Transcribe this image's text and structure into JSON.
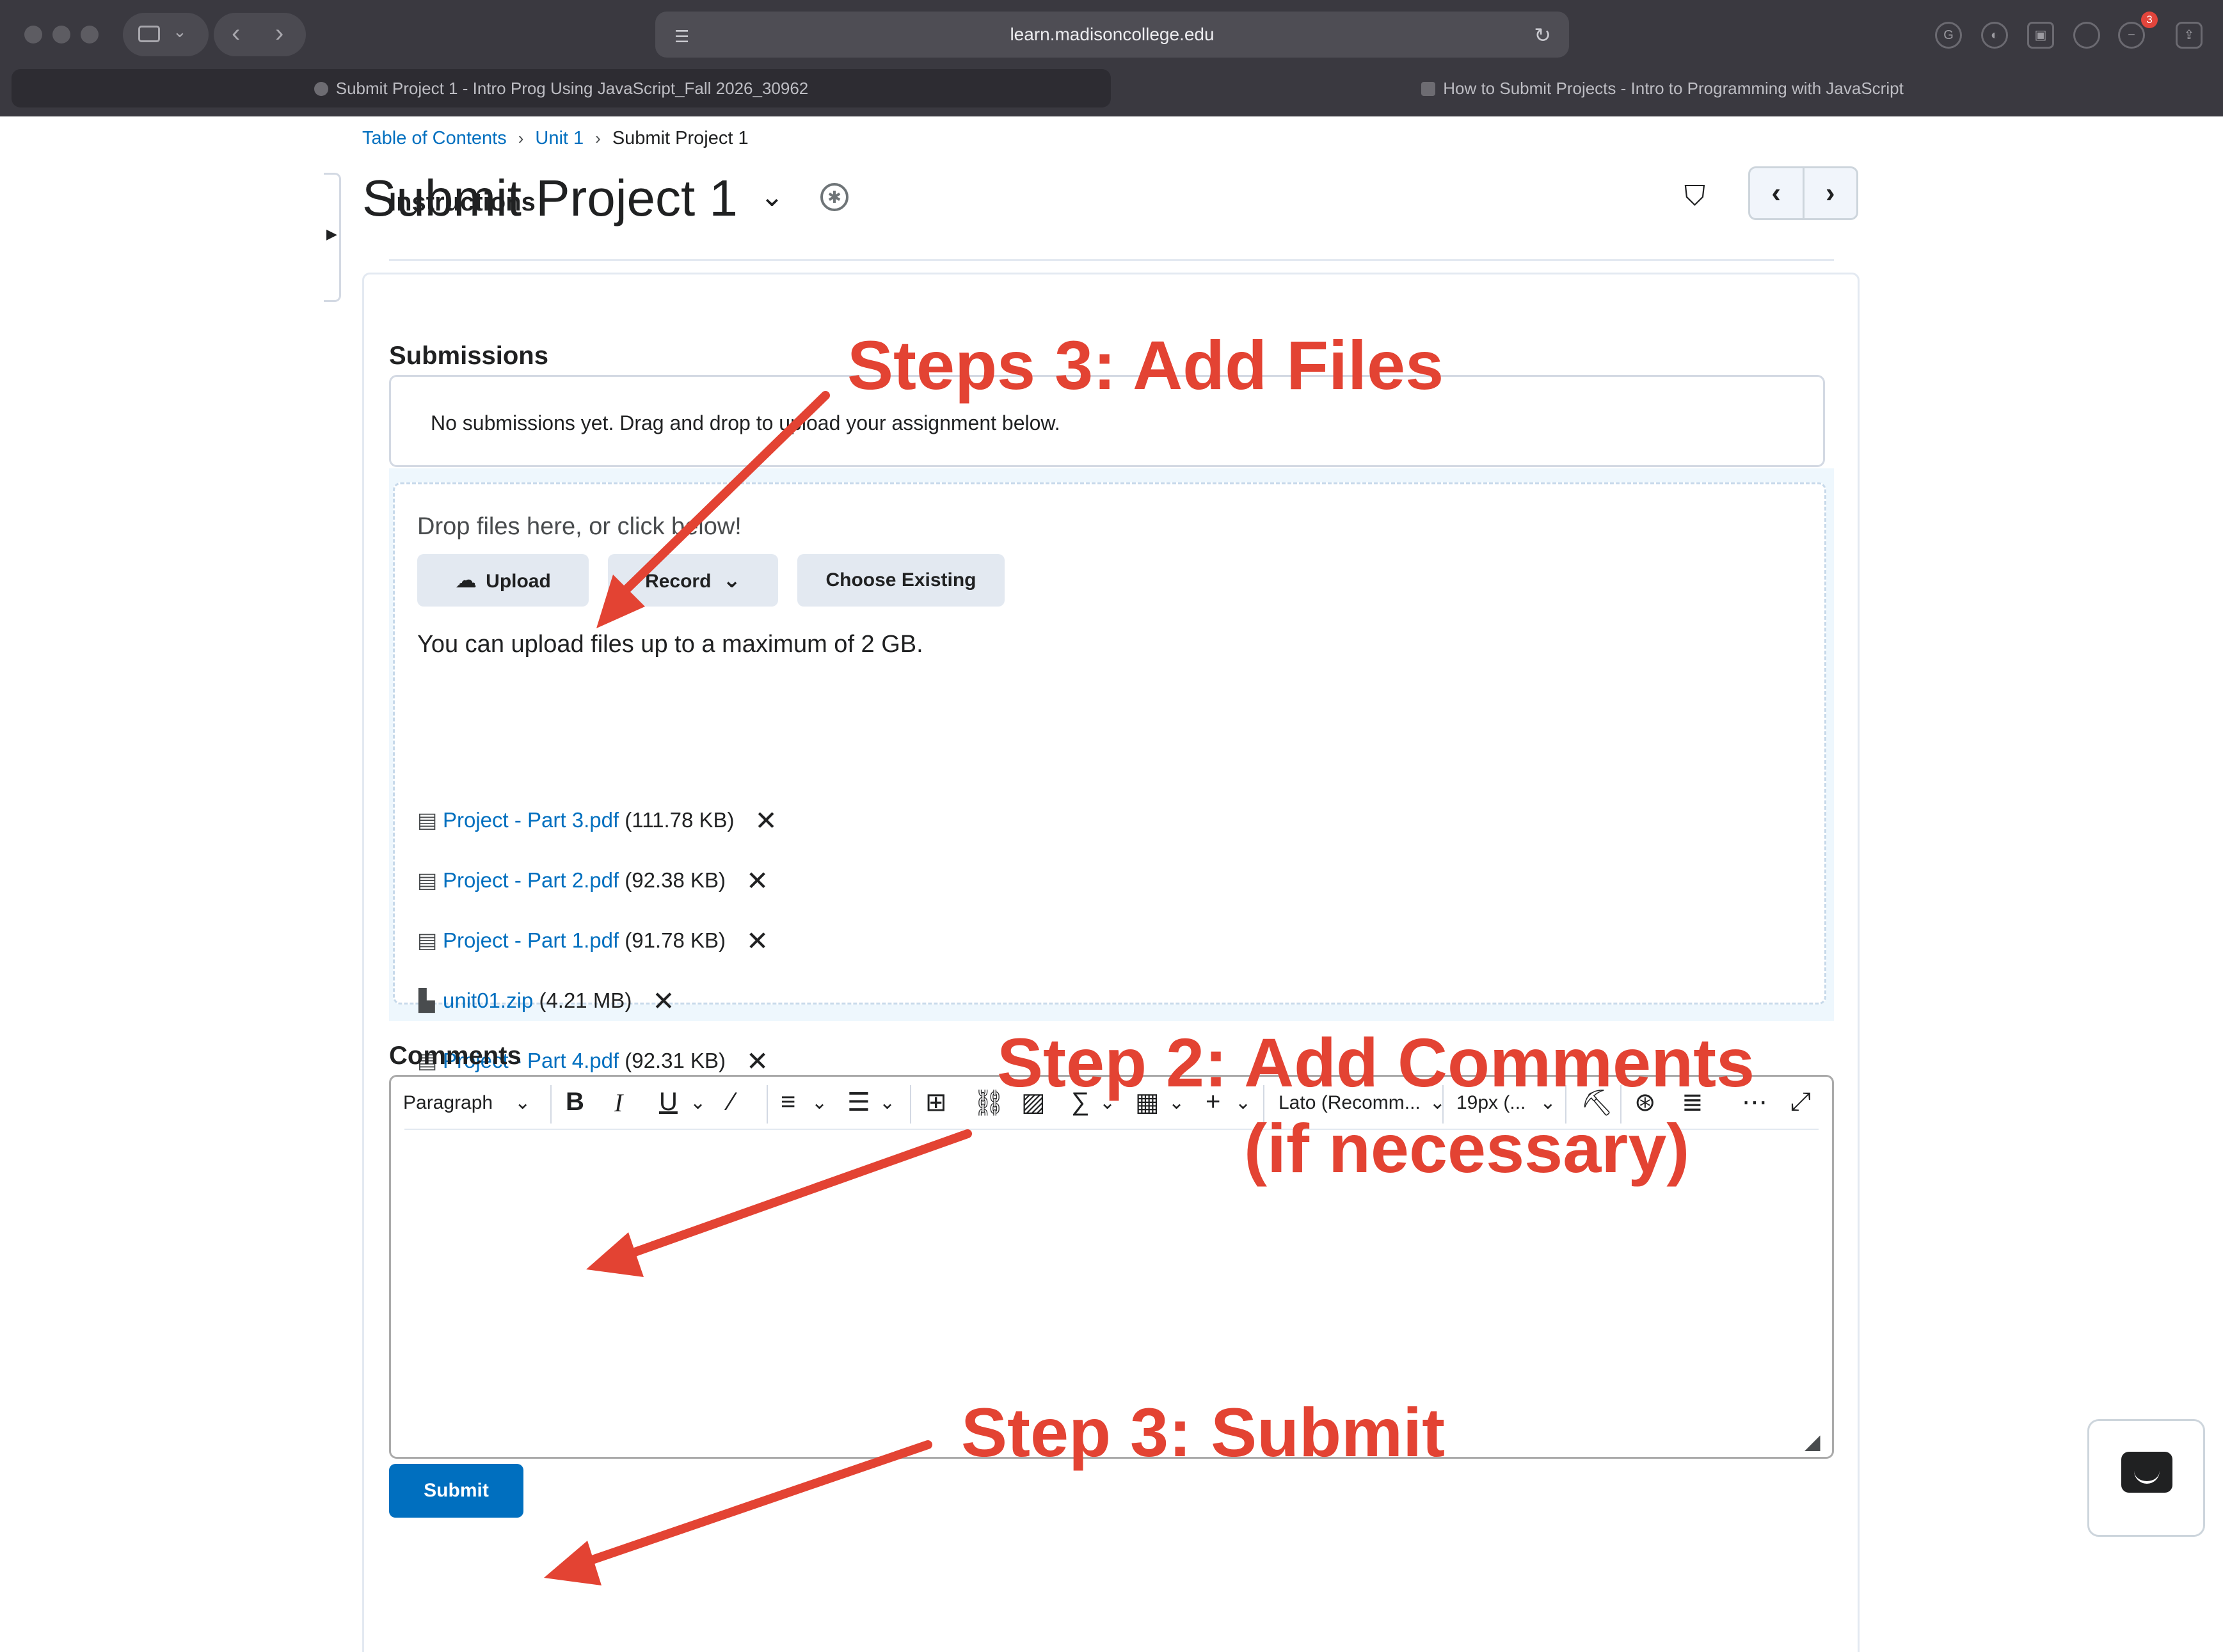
{
  "browser": {
    "url": "learn.madisoncollege.edu",
    "notification_count": "3",
    "tabs": [
      {
        "label": "Submit Project 1 - Intro Prog Using JavaScript_Fall 2026_30962"
      },
      {
        "label": "How to Submit Projects - Intro to Programming with JavaScript"
      }
    ]
  },
  "breadcrumb": {
    "items": [
      "Table of Contents",
      "Unit 1",
      "Submit Project 1"
    ]
  },
  "page": {
    "title": "Submit Project 1",
    "instructions_heading": "Instructions",
    "submissions_heading": "Submissions",
    "no_submissions": "No submissions yet. Drag and drop to upload your assignment below."
  },
  "upload": {
    "drop_message": "Drop files here, or click below!",
    "upload_label": "Upload",
    "record_label": "Record",
    "choose_existing_label": "Choose Existing",
    "max_message": "You can upload files up to a maximum of 2 GB.",
    "files": [
      {
        "name": "Project - Part 3.pdf",
        "size": "(111.78 KB)",
        "icon": "document-icon"
      },
      {
        "name": "Project - Part 2.pdf",
        "size": "(92.38 KB)",
        "icon": "document-icon"
      },
      {
        "name": "Project - Part 1.pdf",
        "size": "(91.78 KB)",
        "icon": "document-icon"
      },
      {
        "name": "unit01.zip",
        "size": "(4.21 MB)",
        "icon": "zip-archive-icon"
      },
      {
        "name": "Project - Part 4.pdf",
        "size": "(92.31 KB)",
        "icon": "document-icon"
      }
    ]
  },
  "comments": {
    "heading": "Comments",
    "toolbar": {
      "block_format": "Paragraph",
      "font_family": "Lato (Recomm...",
      "font_size": "19px (..."
    }
  },
  "actions": {
    "submit_label": "Submit"
  },
  "annotations": {
    "add_files": "Steps 3: Add Files",
    "add_comments_line1": "Step 2: Add Comments",
    "add_comments_line2": "(if necessary)",
    "submit": "Step 3: Submit",
    "color": "#e34333"
  },
  "colors": {
    "link": "#006fbf",
    "primary_button": "#006fbf",
    "annotation": "#e34333"
  }
}
